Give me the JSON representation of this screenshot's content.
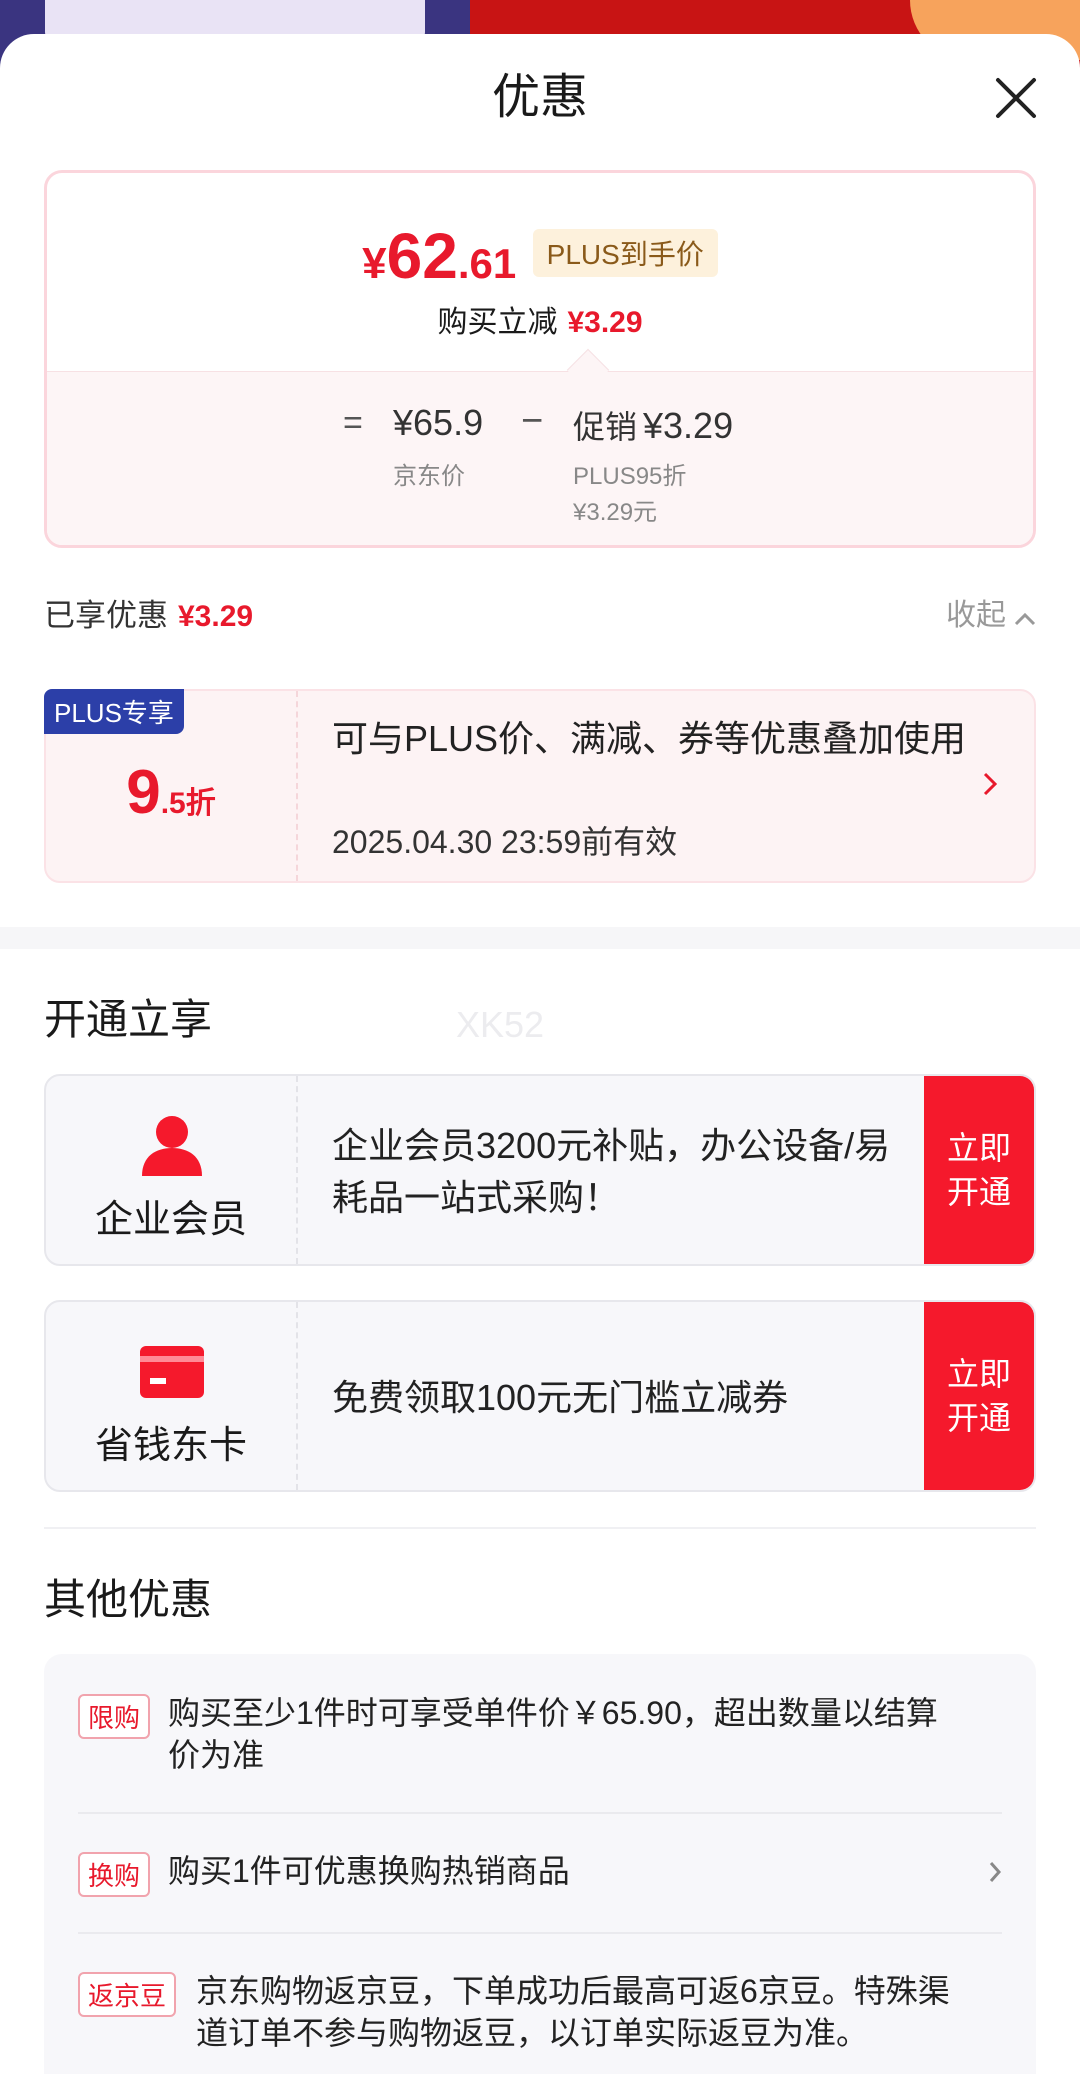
{
  "header": {
    "title": "优惠"
  },
  "price": {
    "currency": "¥",
    "integer": "62",
    "decimal": ".61",
    "tag": "PLUS到手价",
    "sub_label": "购买立减",
    "sub_value": "¥3.29",
    "eq": "=",
    "jd_price": "¥65.9",
    "jd_price_label": "京东价",
    "minus": "−",
    "promo_label": "促销",
    "promo_value": "¥3.29",
    "promo_line1": "PLUS95折",
    "promo_line2": "¥3.29元"
  },
  "enjoyed": {
    "label": "已享优惠",
    "value": "¥3.29",
    "collapse": "收起"
  },
  "plus_card": {
    "flag": "PLUS专享",
    "discount_big": "9",
    "discount_small": ".5折",
    "desc": "可与PLUS价、满减、券等优惠叠加使用",
    "valid": "2025.04.30 23:59前有效"
  },
  "open_section": {
    "title": "开通立享",
    "watermark": "XK52",
    "cards": [
      {
        "icon": "person-icon",
        "label": "企业会员",
        "text": "企业会员3200元补贴，办公设备/易耗品一站式采购！",
        "button": "立即开通"
      },
      {
        "icon": "card-icon",
        "label": "省钱东卡",
        "text": "免费领取100元无门槛立减券",
        "button": "立即开通"
      }
    ]
  },
  "other_section": {
    "title": "其他优惠",
    "items": [
      {
        "tag": "限购",
        "text": "购买至少1件时可享受单件价￥65.90，超出数量以结算价为准"
      },
      {
        "tag": "换购",
        "text": "购买1件可优惠换购热销商品"
      },
      {
        "tag": "返京豆",
        "text": "京东购物返京豆，下单成功后最高可返6京豆。特殊渠道订单不参与购物返豆，以订单实际返豆为准。"
      }
    ]
  },
  "colors": {
    "accent": "#e8192c",
    "plus_blue": "#2c3fa8",
    "plus_tag_bg": "#fdf1dc"
  }
}
